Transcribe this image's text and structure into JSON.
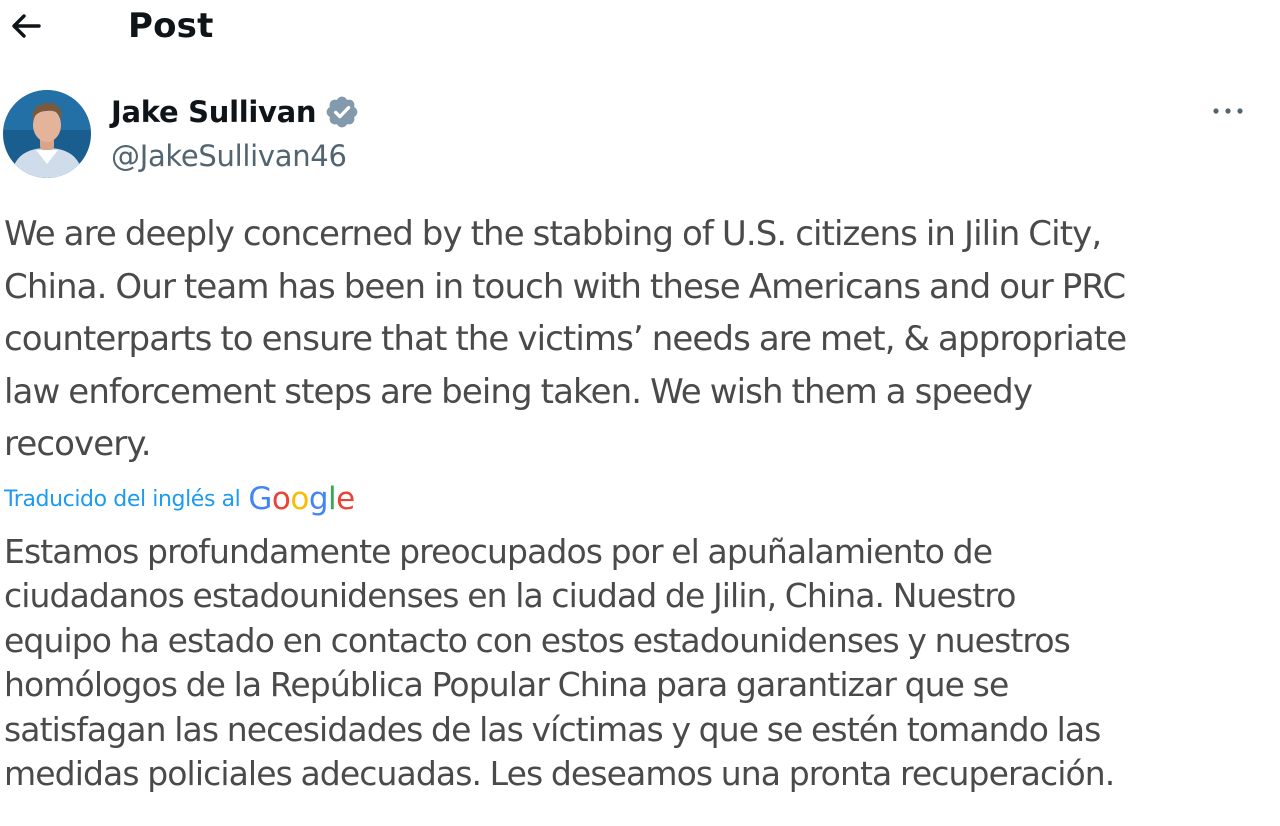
{
  "header": {
    "title": "Post",
    "back_icon": "arrow-left-icon"
  },
  "author": {
    "display_name": "Jake Sullivan",
    "handle": "@JakeSullivan46",
    "verified_icon": "verified-badge-icon",
    "verified_color": "#829aab",
    "avatar_background": "#1a5d8f"
  },
  "more_icon": "more-horizontal-icon",
  "post": {
    "text": "We are deeply concerned by the stabbing of U.S. citizens in Jilin City,\nChina. Our team has been in touch with these Americans and our PRC\ncounterparts to ensure that the victims’ needs are met, & appropriate\nlaw enforcement steps are being taken. We wish them a speedy\nrecovery."
  },
  "translation": {
    "label": "Traducido del inglés al",
    "provider_logo": "Google",
    "provider_colors": [
      "#4285f4",
      "#ea4335",
      "#fbbc05",
      "#4285f4",
      "#34a853",
      "#ea4335"
    ],
    "text": "Estamos profundamente preocupados por el apuñalamiento de\nciudadanos estadounidenses en la ciudad de Jilin, China. Nuestro\nequipo ha estado en contacto con estos estadounidenses y nuestros\nhomólogos de la República Popular China para garantizar que se\nsatisfagan las necesidades de las víctimas y que se estén tomando las\nmedidas policiales adecuadas. Les deseamos una pronta recuperación."
  },
  "colors": {
    "link": "#1d9bf0",
    "secondary_text": "#536471",
    "body_text": "#4a4a4a",
    "primary_text": "#0f1419"
  }
}
